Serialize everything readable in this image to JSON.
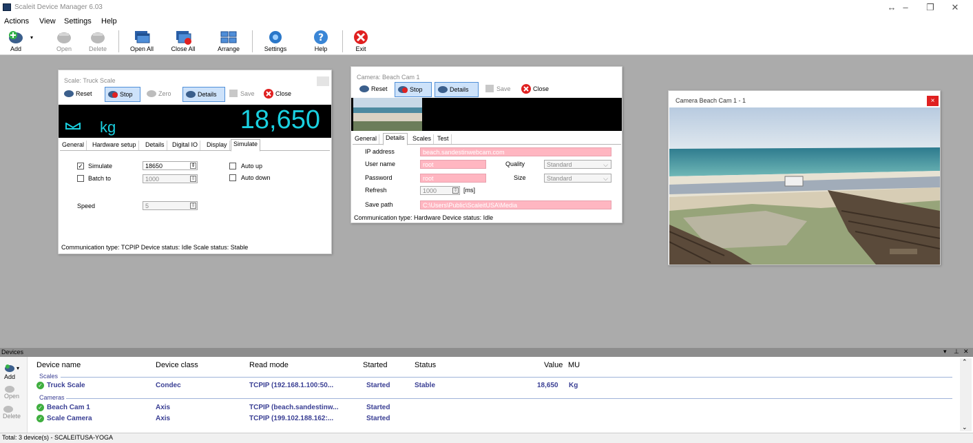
{
  "app": {
    "title": "Scaleit Device Manager 6.03"
  },
  "menu": [
    "Actions",
    "View",
    "Settings",
    "Help"
  ],
  "toolbar": {
    "add": "Add",
    "open": "Open",
    "delete": "Delete",
    "open_all": "Open All",
    "close_all": "Close All",
    "arrange": "Arrange",
    "settings": "Settings",
    "help": "Help",
    "exit": "Exit"
  },
  "scale_window": {
    "title": "Scale: Truck Scale",
    "buttons": {
      "reset": "Reset",
      "stop": "Stop",
      "zero": "Zero",
      "details": "Details",
      "save": "Save",
      "close": "Close"
    },
    "unit": "kg",
    "reading": "18,650",
    "tabs": [
      "General",
      "Hardware setup",
      "Details",
      "Digital IO",
      "Display",
      "Simulate"
    ],
    "simulate": {
      "simulate_label": "Simulate",
      "simulate_checked": "✓",
      "simulate_value": "18650",
      "batch_label": "Batch to",
      "batch_value": "1000",
      "auto_up_label": "Auto up",
      "auto_down_label": "Auto down",
      "speed_label": "Speed",
      "speed_value": "5"
    },
    "status": "Communication type: TCPIP  Device status: Idle  Scale status: Stable"
  },
  "camera_window": {
    "title": "Camera: Beach Cam 1",
    "buttons": {
      "reset": "Reset",
      "stop": "Stop",
      "details": "Details",
      "save": "Save",
      "close": "Close"
    },
    "tabs": [
      "General",
      "Details",
      "Scales",
      "Test"
    ],
    "fields": {
      "ip_label": "IP address",
      "ip_value": "beach.sandestinwebcam.com",
      "user_label": "User name",
      "user_value": "root",
      "quality_label": "Quality",
      "quality_value": "Standard",
      "password_label": "Password",
      "password_value": "root",
      "size_label": "Size",
      "size_value": "Standard",
      "refresh_label": "Refresh",
      "refresh_value": "1000",
      "refresh_unit": "[ms]",
      "save_path_label": "Save path",
      "save_path_value": "C:\\Users\\Public\\ScaleitUSA\\Media"
    },
    "status": "Communication type: Hardware  Device status: Idle"
  },
  "preview_window": {
    "title": "Camera Beach Cam 1 - 1",
    "close": "×"
  },
  "devices": {
    "panel_title": "Devices",
    "side": {
      "add": "Add",
      "open": "Open",
      "delete": "Delete"
    },
    "columns": [
      "Device name",
      "Device class",
      "Read mode",
      "Started",
      "Status",
      "Value",
      "MU"
    ],
    "groups": {
      "scales": "Scales",
      "cameras": "Cameras"
    },
    "rows": [
      {
        "name": "Truck Scale",
        "class": "Condec",
        "read_mode": "TCPIP (192.168.1.100:50...",
        "started": "Started",
        "status": "Stable",
        "value": "18,650",
        "mu": "Kg"
      },
      {
        "name": "Beach Cam 1",
        "class": "Axis",
        "read_mode": "TCPIP (beach.sandestinw...",
        "started": "Started",
        "status": "",
        "value": "",
        "mu": ""
      },
      {
        "name": "Scale Camera",
        "class": "Axis",
        "read_mode": "TCPIP (199.102.188.162:...",
        "started": "Started",
        "status": "",
        "value": "",
        "mu": ""
      }
    ]
  },
  "footer": {
    "text": "Total: 3 device(s) - SCALEITUSA-YOGA"
  },
  "colors": {
    "reading": "#1ad0e0",
    "accent_red": "#e02020",
    "row_text": "#3a3f94",
    "pink_field": "#ffb6c1"
  }
}
